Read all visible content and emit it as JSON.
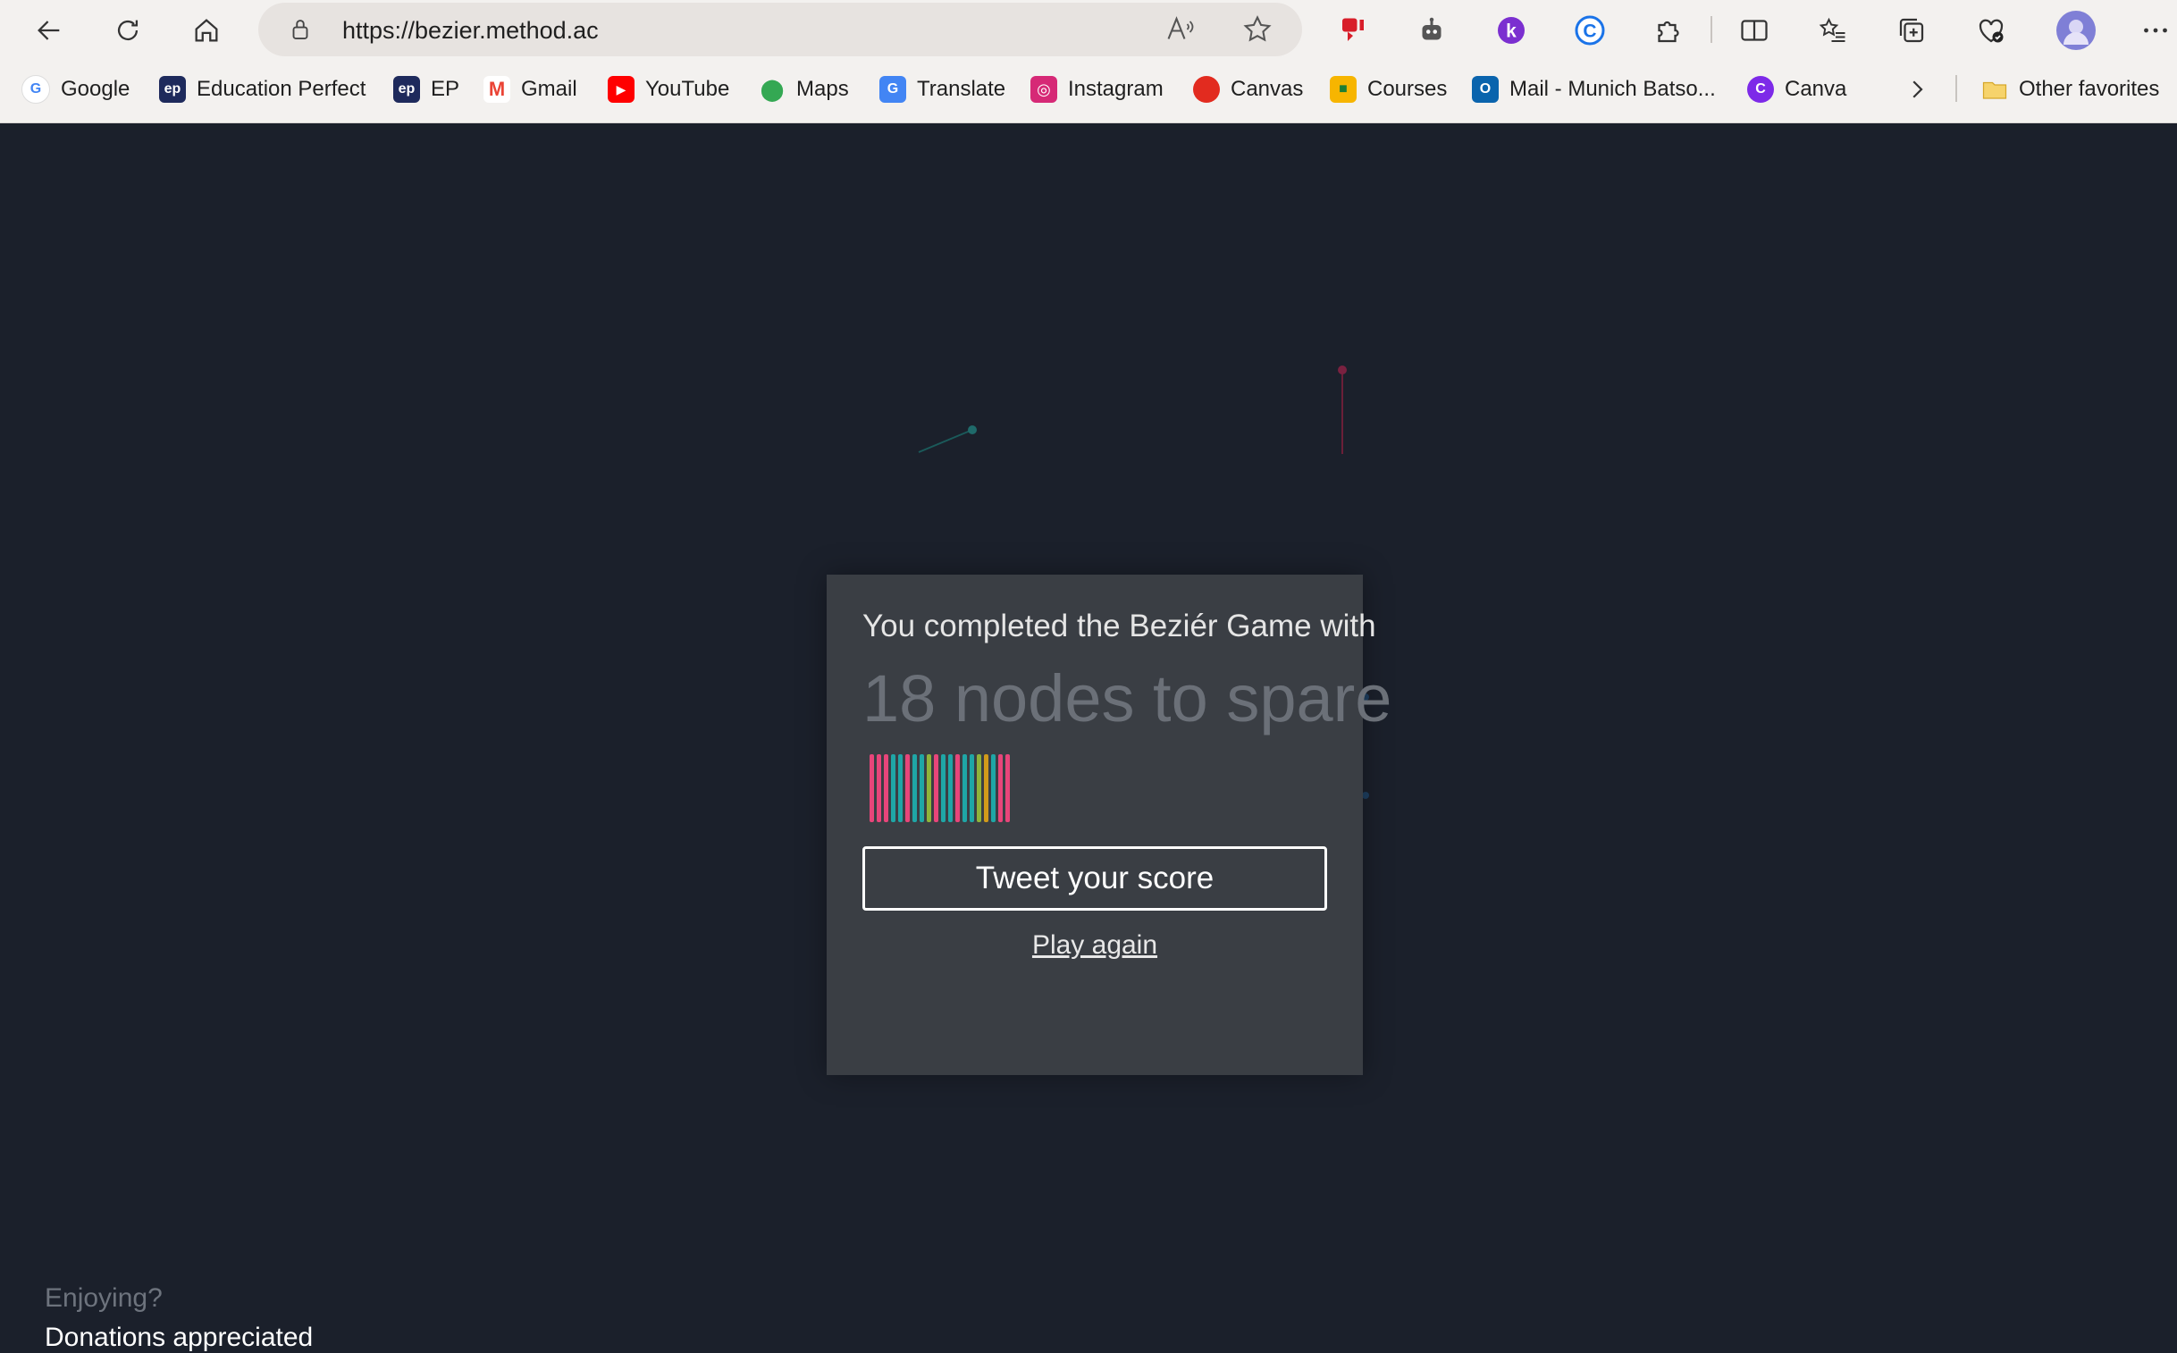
{
  "browser": {
    "url": "https://bezier.method.ac",
    "bookmarks": [
      {
        "label": "Google",
        "icon": "google-icon",
        "color": "#4285f4"
      },
      {
        "label": "Education Perfect",
        "icon": "ep-icon",
        "color": "#1e2a5c"
      },
      {
        "label": "EP",
        "icon": "ep-icon",
        "color": "#1e2a5c"
      },
      {
        "label": "Gmail",
        "icon": "gmail-icon",
        "color": "#ea4335"
      },
      {
        "label": "YouTube",
        "icon": "youtube-icon",
        "color": "#ff0000"
      },
      {
        "label": "Maps",
        "icon": "maps-icon",
        "color": "#34a853"
      },
      {
        "label": "Translate",
        "icon": "translate-icon",
        "color": "#4285f4"
      },
      {
        "label": "Instagram",
        "icon": "instagram-icon",
        "color": "#d62976"
      },
      {
        "label": "Canvas",
        "icon": "canvas-icon",
        "color": "#e22b1f"
      },
      {
        "label": "Courses",
        "icon": "courses-icon",
        "color": "#f7b500"
      },
      {
        "label": "Mail - Munich Batso...",
        "icon": "outlook-icon",
        "color": "#0a64ad"
      },
      {
        "label": "Canva",
        "icon": "canva-icon",
        "color": "#7d2ae8"
      }
    ],
    "other_favorites": "Other favorites"
  },
  "modal": {
    "heading": "You completed the Beziér Game with",
    "score": "18 nodes to spare",
    "bar_colors": [
      "#e8457a",
      "#e8457a",
      "#e8457a",
      "#1fa6a6",
      "#1fa6a6",
      "#e8457a",
      "#1fa6a6",
      "#1fa6a6",
      "#8fb33a",
      "#e8457a",
      "#1fa6a6",
      "#1fa6a6",
      "#e8457a",
      "#1fa6a6",
      "#1fa6a6",
      "#8fb33a",
      "#d19a1a",
      "#1fa6a6",
      "#e8457a",
      "#e8457a"
    ],
    "tweet_label": "Tweet your score",
    "play_again_label": "Play again"
  },
  "footer": {
    "enjoying": "Enjoying?",
    "donations": "Donations appreciated"
  }
}
